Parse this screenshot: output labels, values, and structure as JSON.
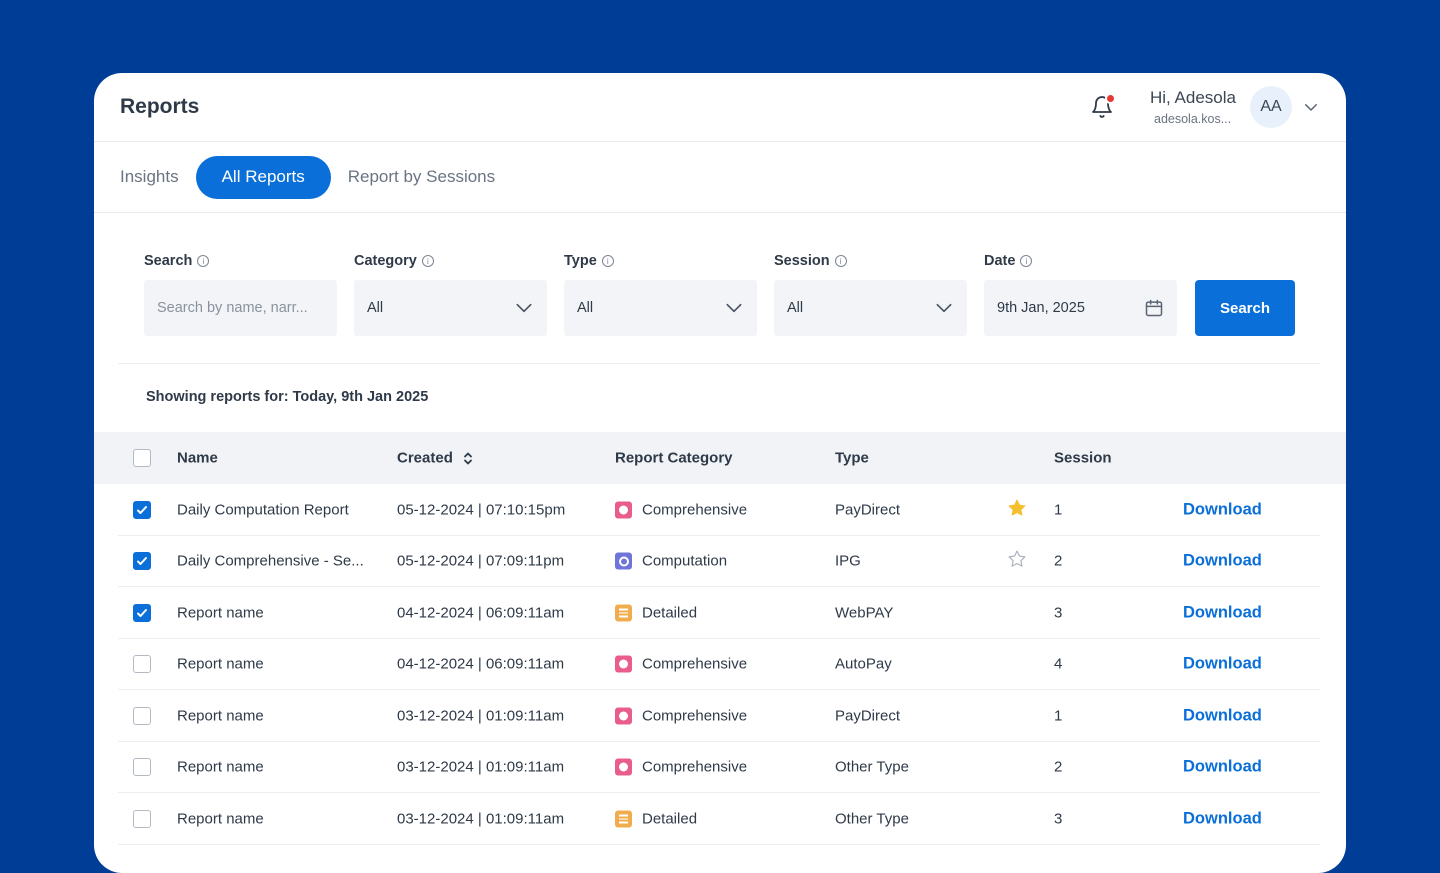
{
  "header": {
    "title": "Reports",
    "user_greeting": "Hi, Adesola",
    "user_email": "adesola.kos...",
    "avatar_initials": "AA"
  },
  "tabs": [
    {
      "label": "Insights",
      "active": false
    },
    {
      "label": "All Reports",
      "active": true
    },
    {
      "label": "Report by Sessions",
      "active": false
    }
  ],
  "filters": {
    "search_label": "Search",
    "search_placeholder": "Search by name, narr...",
    "category_label": "Category",
    "category_value": "All",
    "type_label": "Type",
    "type_value": "All",
    "session_label": "Session",
    "session_value": "All",
    "date_label": "Date",
    "date_value": "9th Jan, 2025",
    "search_button": "Search"
  },
  "showing_text": "Showing reports for: Today, 9th Jan 2025",
  "table": {
    "columns": {
      "name": "Name",
      "created": "Created",
      "category": "Report Category",
      "type": "Type",
      "session": "Session"
    },
    "download_label": "Download",
    "rows": [
      {
        "checked": true,
        "name": "Daily Computation Report",
        "created": "05-12-2024 | 07:10:15pm",
        "category": "Comprehensive",
        "category_icon": "comprehensive-icon",
        "type": "PayDirect",
        "starred": true,
        "session": "1"
      },
      {
        "checked": true,
        "name": "Daily Comprehensive - Se...",
        "created": "05-12-2024  | 07:09:11pm",
        "category": "Computation",
        "category_icon": "computation-icon",
        "type": "IPG",
        "starred": false,
        "session": "2"
      },
      {
        "checked": true,
        "name": "Report name",
        "created": "04-12-2024 | 06:09:11am",
        "category": "Detailed",
        "category_icon": "detailed-icon",
        "type": "WebPAY",
        "starred": null,
        "session": "3"
      },
      {
        "checked": false,
        "name": "Report name",
        "created": "04-12-2024 | 06:09:11am",
        "category": "Comprehensive",
        "category_icon": "comprehensive-icon",
        "type": "AutoPay",
        "starred": null,
        "session": "4"
      },
      {
        "checked": false,
        "name": "Report name",
        "created": "03-12-2024 | 01:09:11am",
        "category": "Comprehensive",
        "category_icon": "comprehensive-icon",
        "type": "PayDirect",
        "starred": null,
        "session": "1"
      },
      {
        "checked": false,
        "name": "Report name",
        "created": "03-12-2024 | 01:09:11am",
        "category": "Comprehensive",
        "category_icon": "comprehensive-icon",
        "type": "Other Type",
        "starred": null,
        "session": "2"
      },
      {
        "checked": false,
        "name": "Report name",
        "created": "03-12-2024 | 01:09:11am",
        "category": "Detailed",
        "category_icon": "detailed-icon",
        "type": "Other Type",
        "starred": null,
        "session": "3"
      }
    ]
  },
  "colors": {
    "background": "#003d96",
    "accent": "#0a6fd8",
    "star": "#f5c02e",
    "notification_dot": "#e53935"
  }
}
